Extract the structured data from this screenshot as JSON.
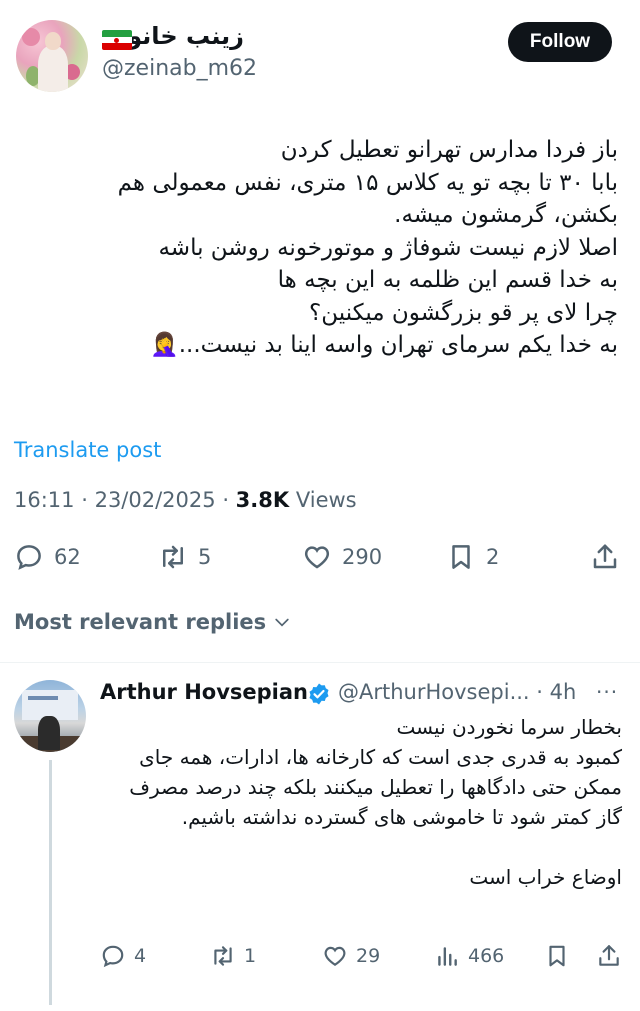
{
  "author": {
    "display_name": "زینب خانوم",
    "handle": "@zeinab_m62",
    "flag_icon": "iran-flag-icon"
  },
  "follow_label": "Follow",
  "tweet": {
    "text": "باز فردا مدارس تهرانو تعطیل کردن\nبابا ۳۰ تا بچه تو یه کلاس ۱۵ متری، نفس معمولی هم بکشن، گرمشون میشه.\nاصلا لازم نیست شوفاژ و موتورخونه روشن باشه\nبه خدا قسم این ظلمه به این بچه ها\nچرا لای پر قو بزرگشون میکنین؟\nبه خدا یکم سرمای تهران واسه اینا بد نیست...🤦‍♀️",
    "translate_label": "Translate post",
    "time": "16:11",
    "date": "23/02/2025",
    "views_count": "3.8K",
    "views_label": "Views",
    "replies": "62",
    "reposts": "5",
    "likes": "290",
    "bookmarks": "2"
  },
  "replies_header": "Most relevant replies",
  "reply": {
    "name": "Arthur Hovsepian",
    "handle": "@ArthurHovsepi...",
    "time": "· 4h",
    "more": "···",
    "text": "بخطار سرما نخوردن نیست\nکمبود به قدری جدی است که کارخانه ها، ادارات، همه جای ممکن حتی دادگاهها را تعطیل میکنند بلکه چند درصد مصرف گاز کمتر شود تا خاموشی های گسترده نداشته باشیم.\n\nاوضاع خراب است",
    "replies": "4",
    "reposts": "1",
    "likes": "29",
    "views": "466"
  },
  "colors": {
    "primary_text": "#0f1419",
    "secondary_text": "#536471",
    "link": "#1d9bf0",
    "verified": "#1d9bf0",
    "button_bg": "#0f1419"
  }
}
